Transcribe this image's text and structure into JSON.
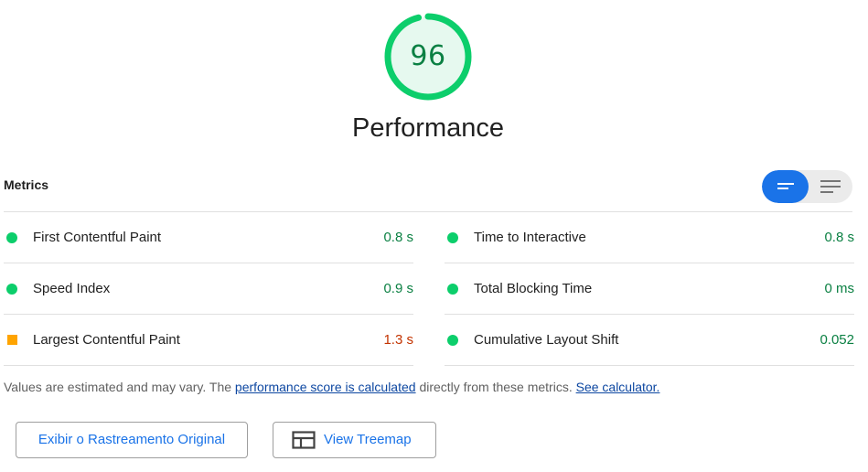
{
  "gauge": {
    "score": "96",
    "score_fraction": 0.96,
    "title": "Performance",
    "color": "#0cce6b",
    "bg_color": "#e6f9ef"
  },
  "metrics": {
    "title": "Metrics",
    "toggle": {
      "selected": "compact-view",
      "left_icon": "compact-list-icon",
      "right_icon": "expanded-list-icon"
    },
    "left": [
      {
        "label": "First Contentful Paint",
        "value": "0.8 s",
        "status": "pass"
      },
      {
        "label": "Speed Index",
        "value": "0.9 s",
        "status": "pass"
      },
      {
        "label": "Largest Contentful Paint",
        "value": "1.3 s",
        "status": "average"
      }
    ],
    "right": [
      {
        "label": "Time to Interactive",
        "value": "0.8 s",
        "status": "pass"
      },
      {
        "label": "Total Blocking Time",
        "value": "0 ms",
        "status": "pass"
      },
      {
        "label": "Cumulative Layout Shift",
        "value": "0.052",
        "status": "pass"
      }
    ]
  },
  "disclaimer": {
    "prefix": "Values are estimated and may vary. The ",
    "link1": "performance score is calculated",
    "middle": " directly from these metrics. ",
    "link2": "See calculator."
  },
  "buttons": {
    "trace": "Exibir o Rastreamento Original",
    "treemap": "View Treemap"
  },
  "colors": {
    "pass": "#0cce6b",
    "average": "#ffa400",
    "accent": "#1a73e8"
  }
}
